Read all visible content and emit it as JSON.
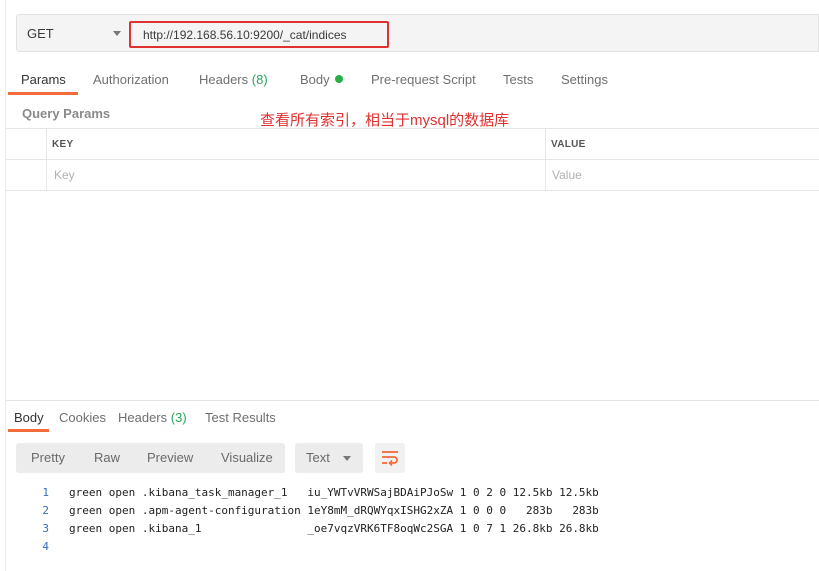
{
  "request": {
    "method": "GET",
    "url": "http://192.168.56.10:9200/_cat/indices"
  },
  "request_tabs": [
    {
      "label": "Params"
    },
    {
      "label": "Authorization"
    },
    {
      "label": "Headers",
      "count": "(8)"
    },
    {
      "label": "Body"
    },
    {
      "label": "Pre-request Script"
    },
    {
      "label": "Tests"
    },
    {
      "label": "Settings"
    }
  ],
  "query_params": {
    "title": "Query Params",
    "annotation": "查看所有索引，相当于mysql的数据库",
    "key_header": "KEY",
    "value_header": "VALUE",
    "key_placeholder": "Key",
    "value_placeholder": "Value"
  },
  "response_tabs": [
    {
      "label": "Body"
    },
    {
      "label": "Cookies"
    },
    {
      "label": "Headers",
      "count": "(3)"
    },
    {
      "label": "Test Results"
    }
  ],
  "view_modes": [
    "Pretty",
    "Raw",
    "Preview",
    "Visualize"
  ],
  "format_select": "Text",
  "colors": {
    "accent": "#f26b3a",
    "annotation": "#e03131",
    "count_green": "#26a65b",
    "line_number": "#2f6fbf"
  },
  "response_lines": [
    {
      "n": "1",
      "text": "green open .kibana_task_manager_1   iu_YWTvVRWSajBDAiPJoSw 1 0 2 0 12.5kb 12.5kb"
    },
    {
      "n": "2",
      "text": "green open .apm-agent-configuration 1eY8mM_dRQWYqxISHG2xZA 1 0 0 0   283b   283b"
    },
    {
      "n": "3",
      "text": "green open .kibana_1                _oe7vqzVRK6TF8oqWc2SGA 1 0 7 1 26.8kb 26.8kb"
    },
    {
      "n": "4",
      "text": ""
    }
  ]
}
